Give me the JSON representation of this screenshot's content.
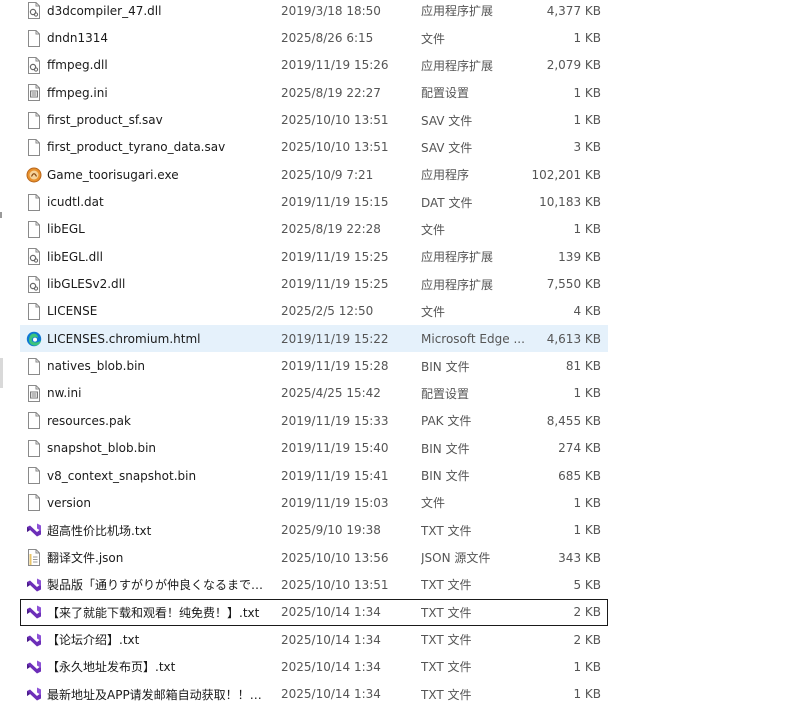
{
  "files": [
    {
      "name": "d3dcompiler_47.dll",
      "date": "2019/3/18 18:50",
      "type": "应用程序扩展",
      "size": "4,377 KB",
      "icon": "dll-icon"
    },
    {
      "name": "dndn1314",
      "date": "2025/8/26 6:15",
      "type": "文件",
      "size": "1 KB",
      "icon": "blank-file-icon"
    },
    {
      "name": "ffmpeg.dll",
      "date": "2019/11/19 15:26",
      "type": "应用程序扩展",
      "size": "2,079 KB",
      "icon": "dll-icon"
    },
    {
      "name": "ffmpeg.ini",
      "date": "2025/8/19 22:27",
      "type": "配置设置",
      "size": "1 KB",
      "icon": "ini-icon"
    },
    {
      "name": "first_product_sf.sav",
      "date": "2025/10/10 13:51",
      "type": "SAV 文件",
      "size": "1 KB",
      "icon": "blank-file-icon"
    },
    {
      "name": "first_product_tyrano_data.sav",
      "date": "2025/10/10 13:51",
      "type": "SAV 文件",
      "size": "3 KB",
      "icon": "blank-file-icon"
    },
    {
      "name": "Game_toorisugari.exe",
      "date": "2025/10/9 7:21",
      "type": "应用程序",
      "size": "102,201 KB",
      "icon": "exe-icon"
    },
    {
      "name": "icudtl.dat",
      "date": "2019/11/19 15:15",
      "type": "DAT 文件",
      "size": "10,183 KB",
      "icon": "blank-file-icon"
    },
    {
      "name": "libEGL",
      "date": "2025/8/19 22:28",
      "type": "文件",
      "size": "1 KB",
      "icon": "blank-file-icon"
    },
    {
      "name": "libEGL.dll",
      "date": "2019/11/19 15:25",
      "type": "应用程序扩展",
      "size": "139 KB",
      "icon": "dll-icon"
    },
    {
      "name": "libGLESv2.dll",
      "date": "2019/11/19 15:25",
      "type": "应用程序扩展",
      "size": "7,550 KB",
      "icon": "dll-icon"
    },
    {
      "name": "LICENSE",
      "date": "2025/2/5 12:50",
      "type": "文件",
      "size": "4 KB",
      "icon": "blank-file-icon"
    },
    {
      "name": "LICENSES.chromium.html",
      "date": "2019/11/19 15:22",
      "type": "Microsoft Edge ...",
      "size": "4,613 KB",
      "icon": "edge-icon"
    },
    {
      "name": "natives_blob.bin",
      "date": "2019/11/19 15:28",
      "type": "BIN 文件",
      "size": "81 KB",
      "icon": "blank-file-icon"
    },
    {
      "name": "nw.ini",
      "date": "2025/4/25 15:42",
      "type": "配置设置",
      "size": "1 KB",
      "icon": "ini-icon"
    },
    {
      "name": "resources.pak",
      "date": "2019/11/19 15:33",
      "type": "PAK 文件",
      "size": "8,455 KB",
      "icon": "blank-file-icon"
    },
    {
      "name": "snapshot_blob.bin",
      "date": "2019/11/19 15:40",
      "type": "BIN 文件",
      "size": "274 KB",
      "icon": "blank-file-icon"
    },
    {
      "name": "v8_context_snapshot.bin",
      "date": "2019/11/19 15:41",
      "type": "BIN 文件",
      "size": "685 KB",
      "icon": "blank-file-icon"
    },
    {
      "name": "version",
      "date": "2019/11/19 15:03",
      "type": "文件",
      "size": "1 KB",
      "icon": "blank-file-icon"
    },
    {
      "name": "超高性价比机场.txt",
      "date": "2025/9/10 19:38",
      "type": "TXT 文件",
      "size": "1 KB",
      "icon": "vs-txt-icon"
    },
    {
      "name": "翻译文件.json",
      "date": "2025/10/10 13:56",
      "type": "JSON 源文件",
      "size": "343 KB",
      "icon": "json-icon"
    },
    {
      "name": "製品版「通りすがりが仲良くなるまで」...",
      "date": "2025/10/10 13:51",
      "type": "TXT 文件",
      "size": "5 KB",
      "icon": "vs-txt-icon"
    },
    {
      "name": "【来了就能下载和观看！纯免费！】.txt",
      "date": "2025/10/14 1:34",
      "type": "TXT 文件",
      "size": "2 KB",
      "icon": "vs-txt-icon"
    },
    {
      "name": "【论坛介绍】.txt",
      "date": "2025/10/14 1:34",
      "type": "TXT 文件",
      "size": "2 KB",
      "icon": "vs-txt-icon"
    },
    {
      "name": "【永久地址发布页】.txt",
      "date": "2025/10/14 1:34",
      "type": "TXT 文件",
      "size": "1 KB",
      "icon": "vs-txt-icon"
    },
    {
      "name": "最新地址及APP请发邮箱自动获取！！！...",
      "date": "2025/10/14 1:34",
      "type": "TXT 文件",
      "size": "1 KB",
      "icon": "vs-txt-icon"
    }
  ],
  "selected_row": "LICENSES.chromium.html",
  "focused_row": "【来了就能下载和观看！纯免费！】.txt",
  "colors": {
    "selection": "#e5f1fb",
    "vs_purple": "#6c2eb8",
    "edge_blue": "#0f78d4",
    "edge_green": "#3cc47c",
    "exe_orange": "#e8912d"
  }
}
